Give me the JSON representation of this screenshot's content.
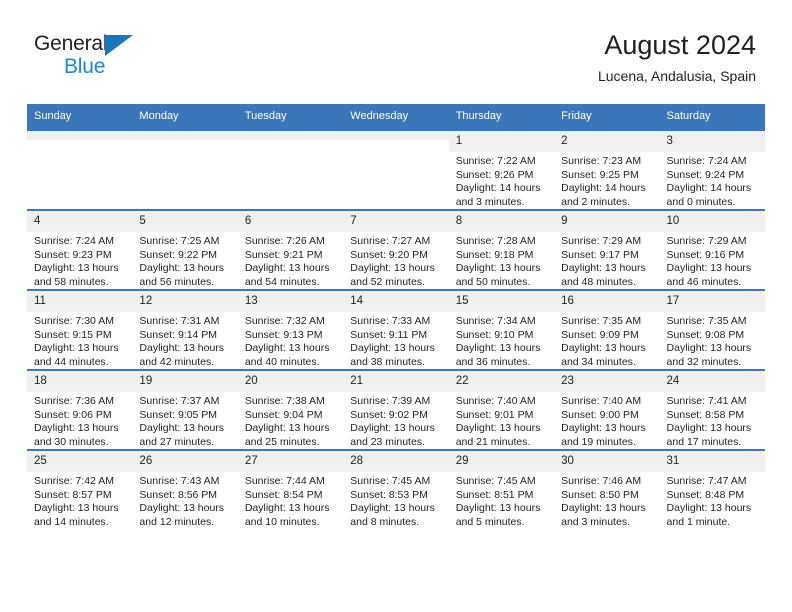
{
  "brand": {
    "name_part1": "General",
    "name_part2": "Blue",
    "triangle_color": "#1b75bb",
    "blue_text_color": "#1b8ad6"
  },
  "header": {
    "title": "August 2024",
    "subtitle": "Lucena, Andalusia, Spain",
    "header_bg_color": "#3a76b8",
    "header_text_color": "#ffffff",
    "daynum_bg_color": "#f0f0f0"
  },
  "weekdays": [
    "Sunday",
    "Monday",
    "Tuesday",
    "Wednesday",
    "Thursday",
    "Friday",
    "Saturday"
  ],
  "weeks": [
    [
      {
        "day": "",
        "empty": true
      },
      {
        "day": "",
        "empty": true
      },
      {
        "day": "",
        "empty": true
      },
      {
        "day": "",
        "empty": true
      },
      {
        "day": "1",
        "sunrise": "Sunrise: 7:22 AM",
        "sunset": "Sunset: 9:26 PM",
        "daylight": "Daylight: 14 hours and 3 minutes."
      },
      {
        "day": "2",
        "sunrise": "Sunrise: 7:23 AM",
        "sunset": "Sunset: 9:25 PM",
        "daylight": "Daylight: 14 hours and 2 minutes."
      },
      {
        "day": "3",
        "sunrise": "Sunrise: 7:24 AM",
        "sunset": "Sunset: 9:24 PM",
        "daylight": "Daylight: 14 hours and 0 minutes."
      }
    ],
    [
      {
        "day": "4",
        "sunrise": "Sunrise: 7:24 AM",
        "sunset": "Sunset: 9:23 PM",
        "daylight": "Daylight: 13 hours and 58 minutes."
      },
      {
        "day": "5",
        "sunrise": "Sunrise: 7:25 AM",
        "sunset": "Sunset: 9:22 PM",
        "daylight": "Daylight: 13 hours and 56 minutes."
      },
      {
        "day": "6",
        "sunrise": "Sunrise: 7:26 AM",
        "sunset": "Sunset: 9:21 PM",
        "daylight": "Daylight: 13 hours and 54 minutes."
      },
      {
        "day": "7",
        "sunrise": "Sunrise: 7:27 AM",
        "sunset": "Sunset: 9:20 PM",
        "daylight": "Daylight: 13 hours and 52 minutes."
      },
      {
        "day": "8",
        "sunrise": "Sunrise: 7:28 AM",
        "sunset": "Sunset: 9:18 PM",
        "daylight": "Daylight: 13 hours and 50 minutes."
      },
      {
        "day": "9",
        "sunrise": "Sunrise: 7:29 AM",
        "sunset": "Sunset: 9:17 PM",
        "daylight": "Daylight: 13 hours and 48 minutes."
      },
      {
        "day": "10",
        "sunrise": "Sunrise: 7:29 AM",
        "sunset": "Sunset: 9:16 PM",
        "daylight": "Daylight: 13 hours and 46 minutes."
      }
    ],
    [
      {
        "day": "11",
        "sunrise": "Sunrise: 7:30 AM",
        "sunset": "Sunset: 9:15 PM",
        "daylight": "Daylight: 13 hours and 44 minutes."
      },
      {
        "day": "12",
        "sunrise": "Sunrise: 7:31 AM",
        "sunset": "Sunset: 9:14 PM",
        "daylight": "Daylight: 13 hours and 42 minutes."
      },
      {
        "day": "13",
        "sunrise": "Sunrise: 7:32 AM",
        "sunset": "Sunset: 9:13 PM",
        "daylight": "Daylight: 13 hours and 40 minutes."
      },
      {
        "day": "14",
        "sunrise": "Sunrise: 7:33 AM",
        "sunset": "Sunset: 9:11 PM",
        "daylight": "Daylight: 13 hours and 38 minutes."
      },
      {
        "day": "15",
        "sunrise": "Sunrise: 7:34 AM",
        "sunset": "Sunset: 9:10 PM",
        "daylight": "Daylight: 13 hours and 36 minutes."
      },
      {
        "day": "16",
        "sunrise": "Sunrise: 7:35 AM",
        "sunset": "Sunset: 9:09 PM",
        "daylight": "Daylight: 13 hours and 34 minutes."
      },
      {
        "day": "17",
        "sunrise": "Sunrise: 7:35 AM",
        "sunset": "Sunset: 9:08 PM",
        "daylight": "Daylight: 13 hours and 32 minutes."
      }
    ],
    [
      {
        "day": "18",
        "sunrise": "Sunrise: 7:36 AM",
        "sunset": "Sunset: 9:06 PM",
        "daylight": "Daylight: 13 hours and 30 minutes."
      },
      {
        "day": "19",
        "sunrise": "Sunrise: 7:37 AM",
        "sunset": "Sunset: 9:05 PM",
        "daylight": "Daylight: 13 hours and 27 minutes."
      },
      {
        "day": "20",
        "sunrise": "Sunrise: 7:38 AM",
        "sunset": "Sunset: 9:04 PM",
        "daylight": "Daylight: 13 hours and 25 minutes."
      },
      {
        "day": "21",
        "sunrise": "Sunrise: 7:39 AM",
        "sunset": "Sunset: 9:02 PM",
        "daylight": "Daylight: 13 hours and 23 minutes."
      },
      {
        "day": "22",
        "sunrise": "Sunrise: 7:40 AM",
        "sunset": "Sunset: 9:01 PM",
        "daylight": "Daylight: 13 hours and 21 minutes."
      },
      {
        "day": "23",
        "sunrise": "Sunrise: 7:40 AM",
        "sunset": "Sunset: 9:00 PM",
        "daylight": "Daylight: 13 hours and 19 minutes."
      },
      {
        "day": "24",
        "sunrise": "Sunrise: 7:41 AM",
        "sunset": "Sunset: 8:58 PM",
        "daylight": "Daylight: 13 hours and 17 minutes."
      }
    ],
    [
      {
        "day": "25",
        "sunrise": "Sunrise: 7:42 AM",
        "sunset": "Sunset: 8:57 PM",
        "daylight": "Daylight: 13 hours and 14 minutes."
      },
      {
        "day": "26",
        "sunrise": "Sunrise: 7:43 AM",
        "sunset": "Sunset: 8:56 PM",
        "daylight": "Daylight: 13 hours and 12 minutes."
      },
      {
        "day": "27",
        "sunrise": "Sunrise: 7:44 AM",
        "sunset": "Sunset: 8:54 PM",
        "daylight": "Daylight: 13 hours and 10 minutes."
      },
      {
        "day": "28",
        "sunrise": "Sunrise: 7:45 AM",
        "sunset": "Sunset: 8:53 PM",
        "daylight": "Daylight: 13 hours and 8 minutes."
      },
      {
        "day": "29",
        "sunrise": "Sunrise: 7:45 AM",
        "sunset": "Sunset: 8:51 PM",
        "daylight": "Daylight: 13 hours and 5 minutes."
      },
      {
        "day": "30",
        "sunrise": "Sunrise: 7:46 AM",
        "sunset": "Sunset: 8:50 PM",
        "daylight": "Daylight: 13 hours and 3 minutes."
      },
      {
        "day": "31",
        "sunrise": "Sunrise: 7:47 AM",
        "sunset": "Sunset: 8:48 PM",
        "daylight": "Daylight: 13 hours and 1 minute."
      }
    ]
  ]
}
